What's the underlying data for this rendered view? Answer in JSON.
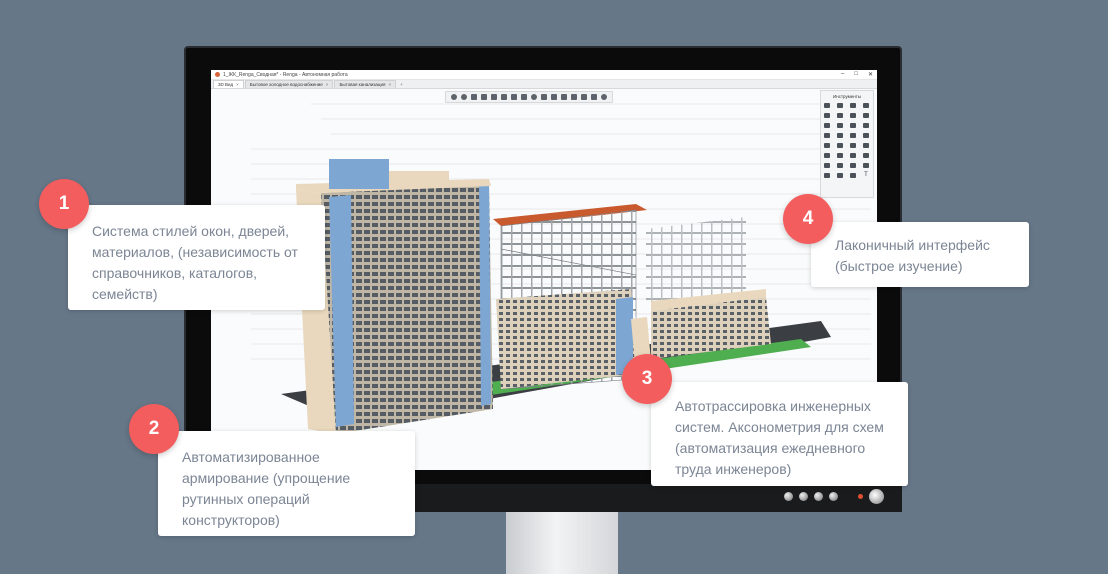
{
  "app": {
    "title": "1_ЖК_Renga_Сводная* - Renga - Автономная работа",
    "window_controls": [
      "–",
      "□",
      "✕"
    ],
    "tabs": [
      {
        "label": "3D Вид",
        "active": true
      },
      {
        "label": "Бытовое холодное водоснабжение",
        "active": false
      },
      {
        "label": "Бытовая канализация",
        "active": false
      }
    ],
    "tab_add": "+",
    "tools_panel_title": "Инструменты",
    "tools_extra_glyph": "T"
  },
  "callouts": [
    {
      "number": "1",
      "text": "Система стилей окон, дверей, материалов, (независимость от справочников, каталогов, семейств)"
    },
    {
      "number": "2",
      "text": "Автоматизированное армирование (упрощение рутинных операций конструкторов)"
    },
    {
      "number": "3",
      "text": "Автотрассировка инженерных систем. Аксонометрия для схем (автоматизация ежедневного труда инженеров)"
    },
    {
      "number": "4",
      "text": "Лаконичный интерфейс (быстрое изучение)"
    }
  ],
  "colors": {
    "background": "#667788",
    "badge": "#f45d5d",
    "callout_text": "#7b8594",
    "facade_beige": "#e9d8bd",
    "facade_blue": "#7ea6d3",
    "roof_red": "#c95a2e",
    "grass": "#4fae4f"
  },
  "icons": {
    "toolbar": [
      "undo-icon",
      "redo-icon",
      "view-icon",
      "layers-icon",
      "camera-icon",
      "section-icon",
      "visibility-icon",
      "print-icon",
      "measure-icon",
      "cut-icon",
      "copy-icon",
      "paste-icon",
      "group-icon",
      "settings-icon",
      "wrench-icon",
      "help-icon"
    ]
  }
}
